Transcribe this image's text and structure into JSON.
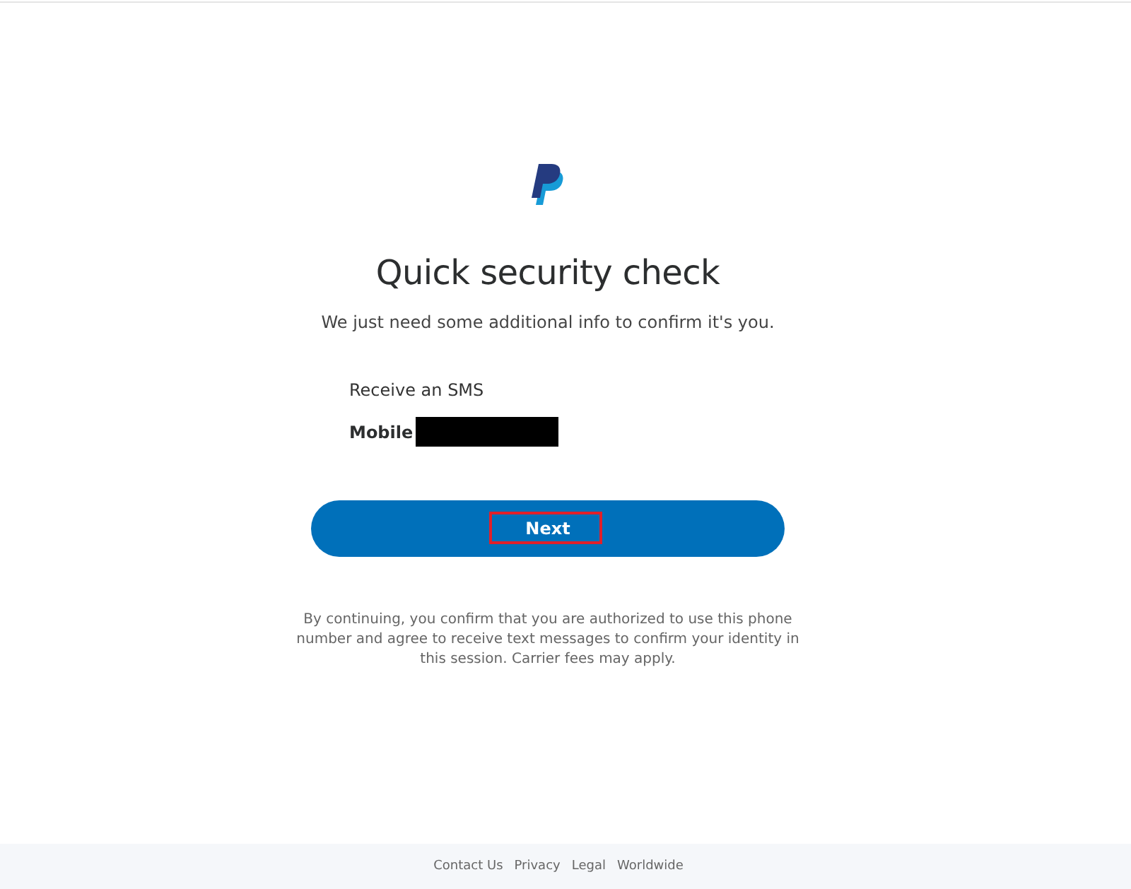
{
  "title": "Quick security check",
  "subtitle": "We just need some additional info to confirm it's you.",
  "method": "Receive an SMS",
  "phone": {
    "label": "Mobile",
    "redacted": true
  },
  "next_button": {
    "label": "Next",
    "highlighted": true
  },
  "disclaimer": "By continuing, you confirm that you are authorized to use this phone number and agree to receive text messages to confirm your identity in this session. Carrier fees may apply.",
  "footer_links": [
    "Contact Us",
    "Privacy",
    "Legal",
    "Worldwide"
  ]
}
